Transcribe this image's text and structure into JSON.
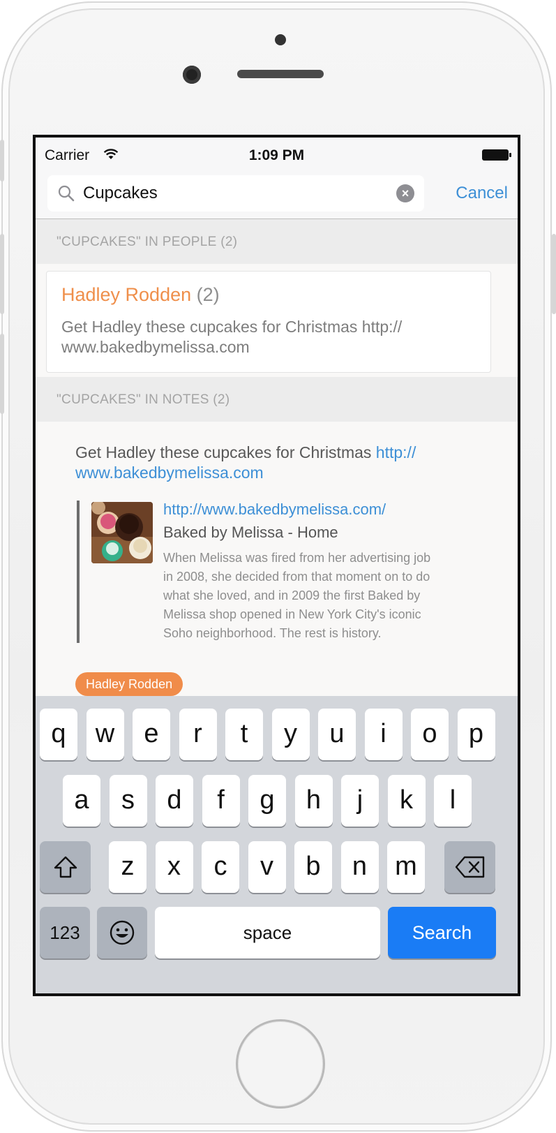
{
  "status_bar": {
    "carrier": "Carrier",
    "time": "1:09 PM"
  },
  "search": {
    "value": "Cupcakes",
    "cancel_label": "Cancel"
  },
  "people_section": {
    "header": "\"CUPCAKES\" IN PEOPLE  (2)",
    "result": {
      "name": "Hadley Rodden",
      "count": "(2)",
      "line1": "Get Hadley these cupcakes for Christmas http://",
      "line2": "www.bakedbymelissa.com"
    }
  },
  "notes_section": {
    "header": "\"CUPCAKES\" IN NOTES  (2)",
    "note": {
      "text": "Get Hadley these cupcakes for Christmas ",
      "link_part1": "http://",
      "link_part2": "www.bakedbymelissa.com"
    },
    "preview": {
      "url": "http://www.bakedbymelissa.com/",
      "title": "Baked by Melissa - Home",
      "description": "When Melissa was fired from her advertising job in 2008, she decided from that moment on to do what she loved, and in 2009 the first Baked by Melissa shop opened in New York City's iconic Soho neighborhood. The rest is history."
    },
    "tag": "Hadley Rodden"
  },
  "keyboard": {
    "row1": [
      "q",
      "w",
      "e",
      "r",
      "t",
      "y",
      "u",
      "i",
      "o",
      "p"
    ],
    "row2": [
      "a",
      "s",
      "d",
      "f",
      "g",
      "h",
      "j",
      "k",
      "l"
    ],
    "row3": [
      "z",
      "x",
      "c",
      "v",
      "b",
      "n",
      "m"
    ],
    "numbers_label": "123",
    "space_label": "space",
    "search_label": "Search",
    "search_color": "#1a7cf5"
  },
  "colors": {
    "accent_orange": "#ef8f4b",
    "link_blue": "#3d8fd6"
  }
}
